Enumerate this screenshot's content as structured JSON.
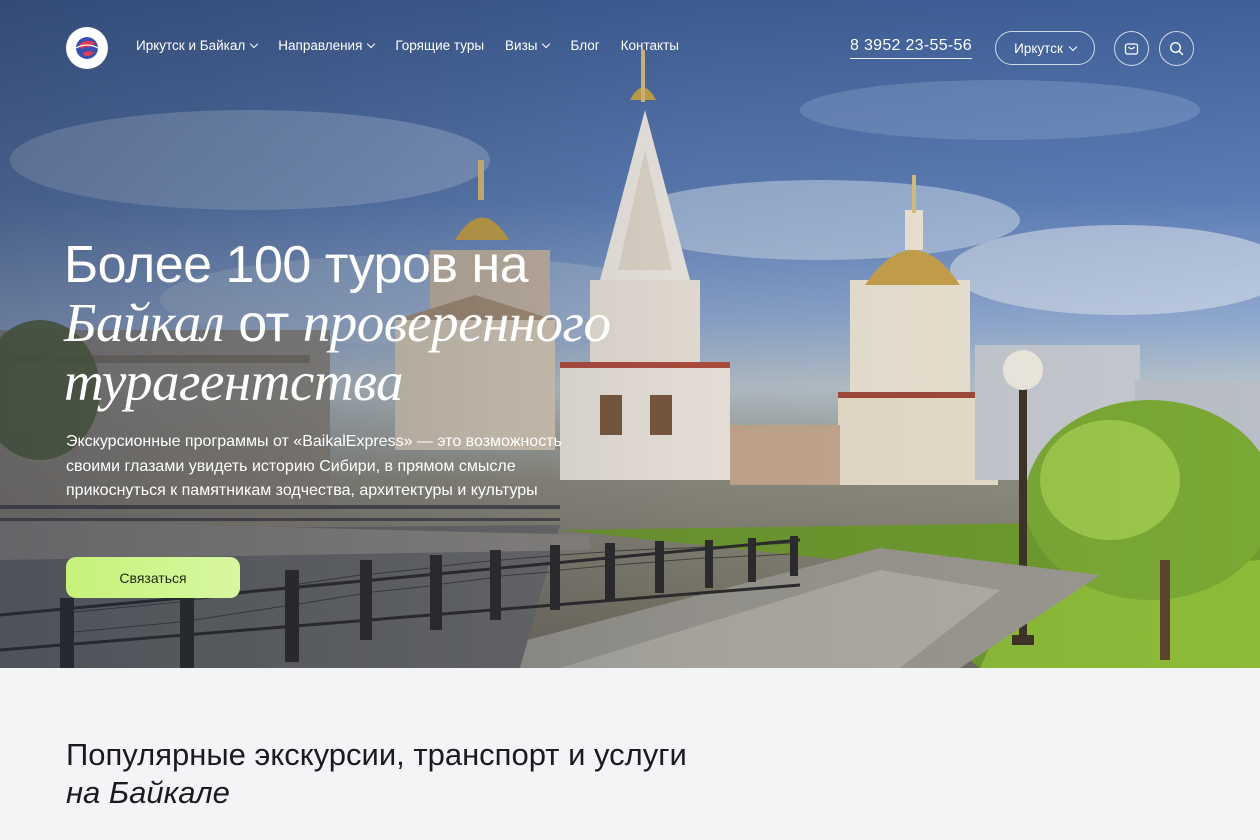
{
  "nav": {
    "logo_icon": "globe-logo-icon",
    "menu": [
      {
        "label": "Иркутск и Байкал",
        "has_dropdown": true
      },
      {
        "label": "Направления",
        "has_dropdown": true
      },
      {
        "label": "Горящие туры",
        "has_dropdown": false
      },
      {
        "label": "Визы",
        "has_dropdown": true
      },
      {
        "label": "Блог",
        "has_dropdown": false
      },
      {
        "label": "Контакты",
        "has_dropdown": false
      }
    ],
    "phone": "8 3952 23-55-56",
    "city": "Иркутск",
    "cart_icon": "cart-icon",
    "search_icon": "search-icon"
  },
  "hero": {
    "headline_part1": "Более 100 туров на",
    "headline_italic1": "Байкал",
    "headline_part2": "от",
    "headline_italic2": "проверенного турагентства",
    "lead": "Экскурсионные программы от «BaikalExpress» — это возможность своими глазами увидеть историю Сибири, в прямом смысле прикоснуться к памятникам зодчества, архитектуры и культуры",
    "cta_label": "Связаться"
  },
  "section": {
    "title_part1": "Популярные экскурсии, транспорт и услуги",
    "title_italic": "на Байкале"
  },
  "colors": {
    "accent": "#c6f27a",
    "page_bg": "#f3f4f6",
    "title_text": "#1b1b1f"
  }
}
